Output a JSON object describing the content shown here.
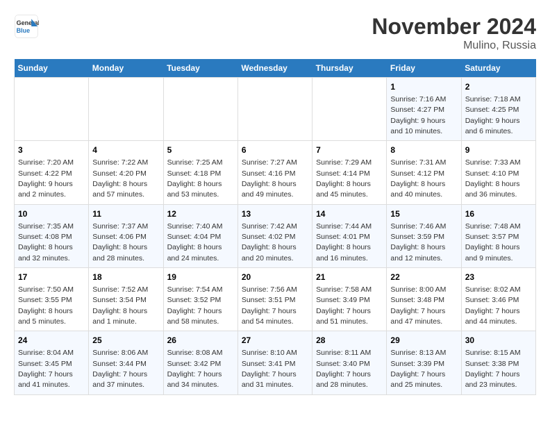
{
  "logo": {
    "general": "General",
    "blue": "Blue"
  },
  "header": {
    "month": "November 2024",
    "location": "Mulino, Russia"
  },
  "weekdays": [
    "Sunday",
    "Monday",
    "Tuesday",
    "Wednesday",
    "Thursday",
    "Friday",
    "Saturday"
  ],
  "weeks": [
    [
      null,
      null,
      null,
      null,
      null,
      {
        "day": "1",
        "sunrise": "Sunrise: 7:16 AM",
        "sunset": "Sunset: 4:27 PM",
        "daylight": "Daylight: 9 hours and 10 minutes."
      },
      {
        "day": "2",
        "sunrise": "Sunrise: 7:18 AM",
        "sunset": "Sunset: 4:25 PM",
        "daylight": "Daylight: 9 hours and 6 minutes."
      }
    ],
    [
      {
        "day": "3",
        "sunrise": "Sunrise: 7:20 AM",
        "sunset": "Sunset: 4:22 PM",
        "daylight": "Daylight: 9 hours and 2 minutes."
      },
      {
        "day": "4",
        "sunrise": "Sunrise: 7:22 AM",
        "sunset": "Sunset: 4:20 PM",
        "daylight": "Daylight: 8 hours and 57 minutes."
      },
      {
        "day": "5",
        "sunrise": "Sunrise: 7:25 AM",
        "sunset": "Sunset: 4:18 PM",
        "daylight": "Daylight: 8 hours and 53 minutes."
      },
      {
        "day": "6",
        "sunrise": "Sunrise: 7:27 AM",
        "sunset": "Sunset: 4:16 PM",
        "daylight": "Daylight: 8 hours and 49 minutes."
      },
      {
        "day": "7",
        "sunrise": "Sunrise: 7:29 AM",
        "sunset": "Sunset: 4:14 PM",
        "daylight": "Daylight: 8 hours and 45 minutes."
      },
      {
        "day": "8",
        "sunrise": "Sunrise: 7:31 AM",
        "sunset": "Sunset: 4:12 PM",
        "daylight": "Daylight: 8 hours and 40 minutes."
      },
      {
        "day": "9",
        "sunrise": "Sunrise: 7:33 AM",
        "sunset": "Sunset: 4:10 PM",
        "daylight": "Daylight: 8 hours and 36 minutes."
      }
    ],
    [
      {
        "day": "10",
        "sunrise": "Sunrise: 7:35 AM",
        "sunset": "Sunset: 4:08 PM",
        "daylight": "Daylight: 8 hours and 32 minutes."
      },
      {
        "day": "11",
        "sunrise": "Sunrise: 7:37 AM",
        "sunset": "Sunset: 4:06 PM",
        "daylight": "Daylight: 8 hours and 28 minutes."
      },
      {
        "day": "12",
        "sunrise": "Sunrise: 7:40 AM",
        "sunset": "Sunset: 4:04 PM",
        "daylight": "Daylight: 8 hours and 24 minutes."
      },
      {
        "day": "13",
        "sunrise": "Sunrise: 7:42 AM",
        "sunset": "Sunset: 4:02 PM",
        "daylight": "Daylight: 8 hours and 20 minutes."
      },
      {
        "day": "14",
        "sunrise": "Sunrise: 7:44 AM",
        "sunset": "Sunset: 4:01 PM",
        "daylight": "Daylight: 8 hours and 16 minutes."
      },
      {
        "day": "15",
        "sunrise": "Sunrise: 7:46 AM",
        "sunset": "Sunset: 3:59 PM",
        "daylight": "Daylight: 8 hours and 12 minutes."
      },
      {
        "day": "16",
        "sunrise": "Sunrise: 7:48 AM",
        "sunset": "Sunset: 3:57 PM",
        "daylight": "Daylight: 8 hours and 9 minutes."
      }
    ],
    [
      {
        "day": "17",
        "sunrise": "Sunrise: 7:50 AM",
        "sunset": "Sunset: 3:55 PM",
        "daylight": "Daylight: 8 hours and 5 minutes."
      },
      {
        "day": "18",
        "sunrise": "Sunrise: 7:52 AM",
        "sunset": "Sunset: 3:54 PM",
        "daylight": "Daylight: 8 hours and 1 minute."
      },
      {
        "day": "19",
        "sunrise": "Sunrise: 7:54 AM",
        "sunset": "Sunset: 3:52 PM",
        "daylight": "Daylight: 7 hours and 58 minutes."
      },
      {
        "day": "20",
        "sunrise": "Sunrise: 7:56 AM",
        "sunset": "Sunset: 3:51 PM",
        "daylight": "Daylight: 7 hours and 54 minutes."
      },
      {
        "day": "21",
        "sunrise": "Sunrise: 7:58 AM",
        "sunset": "Sunset: 3:49 PM",
        "daylight": "Daylight: 7 hours and 51 minutes."
      },
      {
        "day": "22",
        "sunrise": "Sunrise: 8:00 AM",
        "sunset": "Sunset: 3:48 PM",
        "daylight": "Daylight: 7 hours and 47 minutes."
      },
      {
        "day": "23",
        "sunrise": "Sunrise: 8:02 AM",
        "sunset": "Sunset: 3:46 PM",
        "daylight": "Daylight: 7 hours and 44 minutes."
      }
    ],
    [
      {
        "day": "24",
        "sunrise": "Sunrise: 8:04 AM",
        "sunset": "Sunset: 3:45 PM",
        "daylight": "Daylight: 7 hours and 41 minutes."
      },
      {
        "day": "25",
        "sunrise": "Sunrise: 8:06 AM",
        "sunset": "Sunset: 3:44 PM",
        "daylight": "Daylight: 7 hours and 37 minutes."
      },
      {
        "day": "26",
        "sunrise": "Sunrise: 8:08 AM",
        "sunset": "Sunset: 3:42 PM",
        "daylight": "Daylight: 7 hours and 34 minutes."
      },
      {
        "day": "27",
        "sunrise": "Sunrise: 8:10 AM",
        "sunset": "Sunset: 3:41 PM",
        "daylight": "Daylight: 7 hours and 31 minutes."
      },
      {
        "day": "28",
        "sunrise": "Sunrise: 8:11 AM",
        "sunset": "Sunset: 3:40 PM",
        "daylight": "Daylight: 7 hours and 28 minutes."
      },
      {
        "day": "29",
        "sunrise": "Sunrise: 8:13 AM",
        "sunset": "Sunset: 3:39 PM",
        "daylight": "Daylight: 7 hours and 25 minutes."
      },
      {
        "day": "30",
        "sunrise": "Sunrise: 8:15 AM",
        "sunset": "Sunset: 3:38 PM",
        "daylight": "Daylight: 7 hours and 23 minutes."
      }
    ]
  ]
}
